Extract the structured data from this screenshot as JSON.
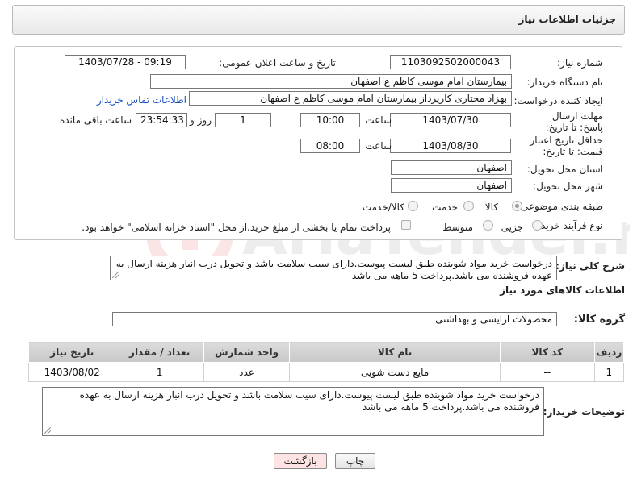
{
  "header": {
    "title": "جزئیات اطلاعات نیاز"
  },
  "form": {
    "need_number_label": "شماره نیاز:",
    "need_number": "1103092502000043",
    "announce_label": "تاریخ و ساعت اعلان عمومی:",
    "announce_value": "1403/07/28 - 09:19",
    "buyer_label": "نام دستگاه خریدار:",
    "buyer_value": "بیمارستان امام موسی کاظم ع  اصفهان",
    "creator_label": "ایجاد کننده درخواست:",
    "creator_value": "بهزاد مختاری کارپرداز بیمارستان امام موسی کاظم ع  اصفهان",
    "contact_link": "اطلاعات تماس خریدار",
    "deadline_label": "مهلت ارسال پاسخ: تا تاریخ:",
    "deadline_date": "1403/07/30",
    "time_label": "ساعت",
    "deadline_time": "10:00",
    "days_value": "1",
    "days_label": "روز و",
    "remaining_value": "23:54:33",
    "remaining_label": "ساعت باقی مانده",
    "validity_label": "حداقل تاریخ اعتبار قیمت: تا تاریخ:",
    "validity_date": "1403/08/30",
    "validity_time": "08:00",
    "province_label": "استان محل تحویل:",
    "province_value": "اصفهان",
    "city_label": "شهر محل تحویل:",
    "city_value": "اصفهان",
    "category_label": "طبقه بندی موضوعی:",
    "category_options": [
      "کالا",
      "خدمت",
      "کالا/خدمت"
    ],
    "process_label": "نوع فرآیند خرید :",
    "process_options": [
      "جزیی",
      "متوسط"
    ],
    "payment_note": "پرداخت تمام یا بخشی از مبلغ خرید،از محل \"اسناد خزانه اسلامی\" خواهد بود."
  },
  "description": {
    "label": "شرح کلی نیاز:",
    "text": "درخواست خرید مواد شوینده طبق لیست پیوست.دارای سیب سلامت باشد و تحویل درب انبار هزینه ارسال به عهده فروشنده می باشد.پرداخت 5 ماهه می باشد"
  },
  "goods_section_title": "اطلاعات کالاهای مورد نیاز",
  "goods_group": {
    "label": "گروه کالا:",
    "value": "محصولات آرایشی و بهداشتی"
  },
  "table": {
    "headers": [
      "ردیف",
      "کد کالا",
      "نام کالا",
      "واحد شمارش",
      "تعداد / مقدار",
      "تاریخ نیاز"
    ],
    "rows": [
      [
        "1",
        "--",
        "مایع دست شویی",
        "عدد",
        "1",
        "1403/08/02"
      ]
    ]
  },
  "buyer_notes": {
    "label": "توضیحات خریدار:",
    "text": "درخواست خرید مواد شوینده طبق لیست پیوست.دارای سیب سلامت باشد و تحویل درب انبار هزینه ارسال به عهده فروشنده می باشد.پرداخت 5 ماهه می باشد"
  },
  "buttons": {
    "print": "چاپ",
    "back": "بازگشت"
  },
  "colors": {
    "back_button_bg": "#fde3e3",
    "link": "#1a4fc0",
    "watermark": "#e33b3b"
  }
}
